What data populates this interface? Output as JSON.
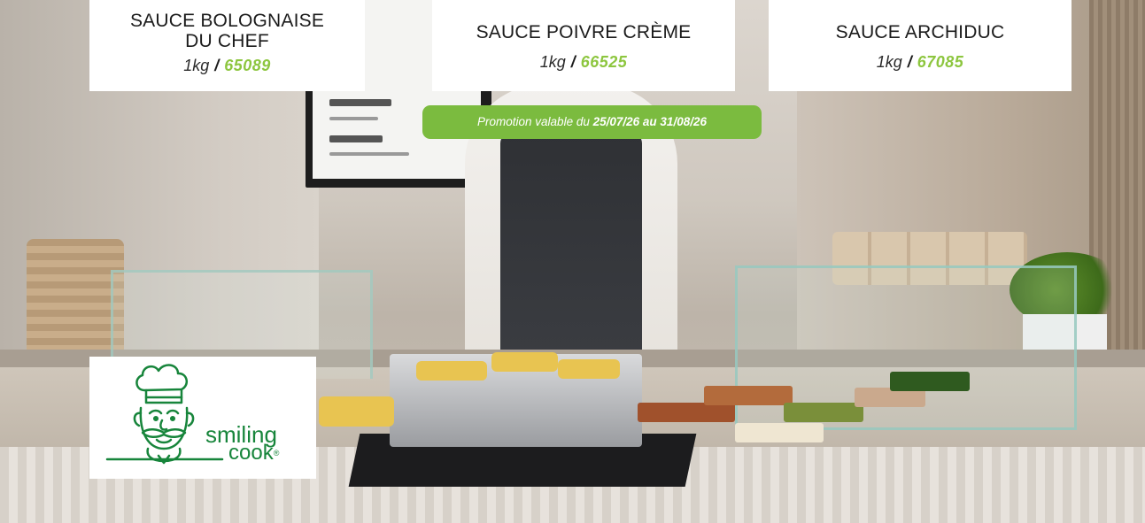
{
  "products": [
    {
      "name": "SAUCE BOLOGNAISE\nDU CHEF",
      "weight": "1kg",
      "separator": "/",
      "code": "65089"
    },
    {
      "name": "SAUCE POIVRE CRÈME",
      "weight": "1kg",
      "separator": "/",
      "code": "66525"
    },
    {
      "name": "SAUCE ARCHIDUC",
      "weight": "1kg",
      "separator": "/",
      "code": "67085"
    }
  ],
  "promo": {
    "prefix": "Promotion valable du ",
    "start": "25/07/26",
    "middle": " au ",
    "end": "31/08/26"
  },
  "logo": {
    "word1": "smiling",
    "word2": "cook",
    "mark": "®"
  },
  "colors": {
    "accent_green": "#8dc63f",
    "promo_green": "#7bbb3f",
    "logo_green": "#17853b"
  },
  "icons": [
    "chef-logo-icon"
  ]
}
